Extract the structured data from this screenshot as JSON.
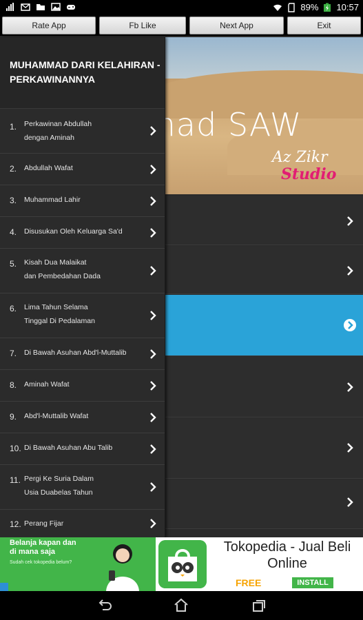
{
  "status_bar": {
    "battery": "89%",
    "time": "10:57",
    "left_icons": [
      "signal-bars-icon",
      "mail-icon",
      "folder-icon",
      "image-icon",
      "gamepad-icon"
    ],
    "right_icons": [
      "wifi-icon",
      "sd-card-icon",
      "battery-charging-icon"
    ]
  },
  "toolbar": {
    "rate_app": "Rate App",
    "fb_like": "Fb Like",
    "next_app": "Next App",
    "exit": "Exit"
  },
  "banner": {
    "title_fragment": "mad SAW",
    "brand_line1": "Az Zikr",
    "brand_line2": "Studio"
  },
  "drawer": {
    "title": "MUHAMMAD DARI KELAHIRAN - PERKAWINANNYA",
    "items": [
      {
        "num": "1.",
        "line1": "Perkawinan Abdullah",
        "line2": "dengan Aminah"
      },
      {
        "num": "2.",
        "line1": "Abdullah Wafat",
        "line2": ""
      },
      {
        "num": "3.",
        "line1": "Muhammad Lahir",
        "line2": ""
      },
      {
        "num": "4.",
        "line1": "Disusukan Oleh Keluarga Sa'd",
        "line2": ""
      },
      {
        "num": "5.",
        "line1": "Kisah Dua Malaikat",
        "line2": "dan Pembedahan Dada"
      },
      {
        "num": "6.",
        "line1": "Lima Tahun Selama",
        "line2": "Tinggal Di Pedalaman"
      },
      {
        "num": "7.",
        "line1": "Di Bawah Asuhan Abd'l-Muttalib",
        "line2": ""
      },
      {
        "num": "8.",
        "line1": "Aminah Wafat",
        "line2": ""
      },
      {
        "num": "9.",
        "line1": "Abd'l-Muttalib Wafat",
        "line2": ""
      },
      {
        "num": "10.",
        "line1": "Di Bawah Asuhan Abu Talib",
        "line2": ""
      },
      {
        "num": "11.",
        "line1": "Pergi Ke Suria Dalam",
        "line2": "Usia Duabelas Tahun"
      },
      {
        "num": "12.",
        "line1": "Perang Fijar",
        "line2": ""
      }
    ]
  },
  "ad": {
    "headline_line1": "Belanja kapan dan",
    "headline_line2": "di mana saja",
    "subline": "Sudah cek tokopedia belum?",
    "app_name": "Tokopedia - Jual Beli Online",
    "price": "FREE",
    "cta": "INSTALL"
  },
  "colors": {
    "selected_row": "#2aa3d8",
    "drawer_bg": "#2b2b2b",
    "ad_green": "#42b549",
    "studio_pink": "#e21d73"
  },
  "nav_bar": {
    "icons": [
      "back-icon",
      "home-icon",
      "recents-icon"
    ]
  }
}
